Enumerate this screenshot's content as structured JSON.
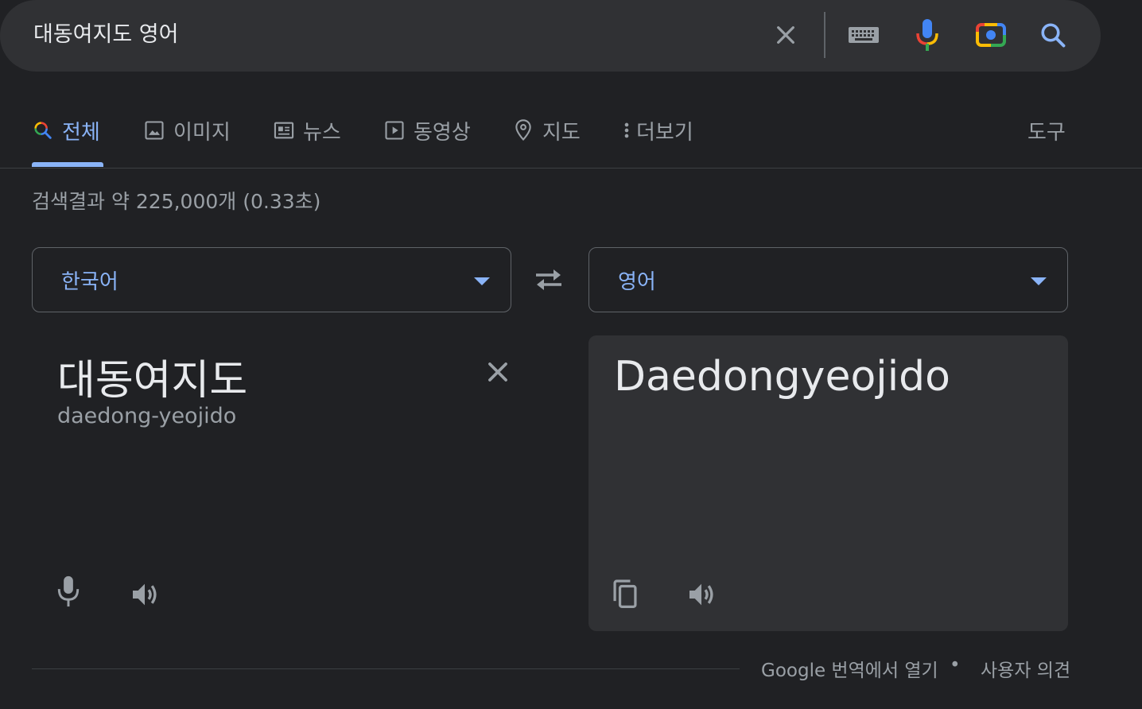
{
  "search": {
    "query": "대동여지도 영어"
  },
  "tabs": [
    {
      "label": "전체",
      "active": true
    },
    {
      "label": "이미지"
    },
    {
      "label": "뉴스"
    },
    {
      "label": "동영상"
    },
    {
      "label": "지도"
    },
    {
      "label": "더보기"
    }
  ],
  "tools_label": "도구",
  "result_stats": "검색결과 약 225,000개 (0.33초)",
  "translator": {
    "source_language": "한국어",
    "target_language": "영어",
    "source_text": "대동여지도",
    "romanization": "daedong-yeojido",
    "target_text": "Daedongyeojido"
  },
  "footer": {
    "open_in_translate": "Google 번역에서 열기",
    "separator": "•",
    "feedback": "사용자 의견"
  },
  "colors": {
    "background": "#202124",
    "surface": "#303134",
    "accent": "#8ab4f8",
    "muted_text": "#9aa0a6"
  }
}
